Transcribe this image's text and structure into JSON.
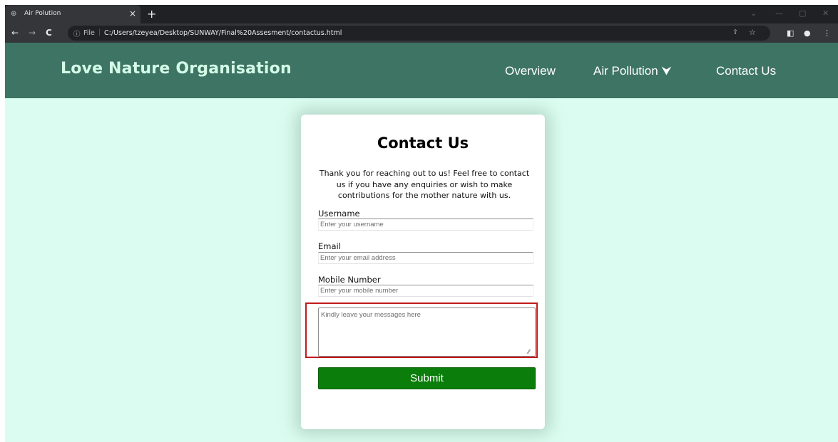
{
  "browser": {
    "tab_title": "Air Polution",
    "tab_close": "×",
    "new_tab": "+",
    "back": "←",
    "forward": "→",
    "reload": "C",
    "info_icon": "ⓘ",
    "scheme_label": "File",
    "separator": "|",
    "url": "C:/Users/tzeyea/Desktop/SUNWAY/Final%20Assesment/contactus.html",
    "share_icon": "⇪",
    "star_icon": "☆",
    "sidepanel_icon": "◧",
    "profile_icon": "●",
    "menu_icon": "⋮",
    "win_minimize": "—",
    "win_restore": "▢",
    "win_close": "✕",
    "tab_dropdown": "⌄"
  },
  "header": {
    "brand": "Love Nature Organisation",
    "nav": [
      {
        "label": "Overview"
      },
      {
        "label": "Air Pollution ⮟"
      },
      {
        "label": "Contact Us"
      }
    ]
  },
  "contact": {
    "title": "Contact Us",
    "intro": "Thank you for reaching out to us! Feel free to contact us if you have any enquiries or wish to make contributions for the mother nature with us.",
    "username_label": "Username",
    "username_placeholder": "Enter your username",
    "email_label": "Email",
    "email_placeholder": "Enter your email address",
    "mobile_label": "Mobile Number",
    "mobile_placeholder": "Enter your mobile number",
    "message_placeholder": "Kindly leave your messages here",
    "submit_label": "Submit"
  },
  "colors": {
    "header_bg": "#3e7464",
    "brand_text": "#d4fbe8",
    "page_bg": "#dbfdf1",
    "submit_bg": "#0a7d0a",
    "highlight_border": "#c21a1a"
  }
}
